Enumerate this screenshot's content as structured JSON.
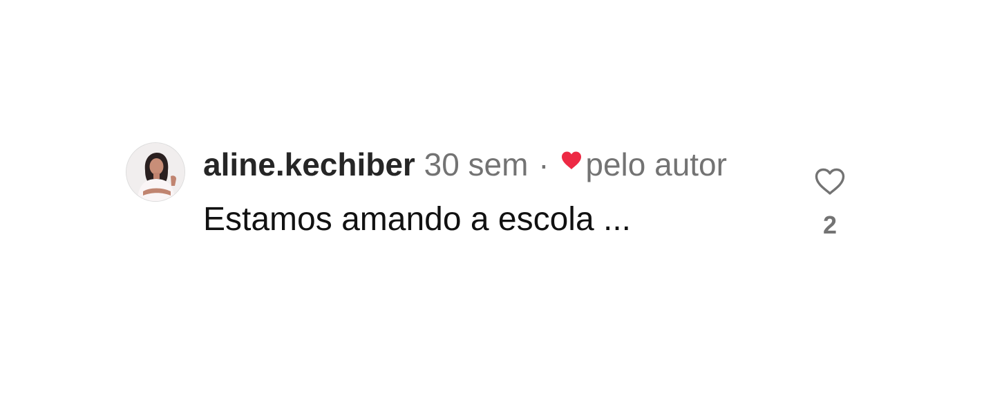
{
  "comment": {
    "username": "aline.kechiber",
    "timestamp": "30 sem",
    "separator": "·",
    "liked_by_author_label": "pelo autor",
    "text": "Estamos amando a escola ...",
    "like_count": "2",
    "icons": {
      "author_heart": "heart-filled-icon",
      "like": "heart-outline-icon"
    },
    "colors": {
      "author_heart": "#ed2944",
      "username": "#262626",
      "meta": "#737373",
      "text": "#111111"
    }
  }
}
